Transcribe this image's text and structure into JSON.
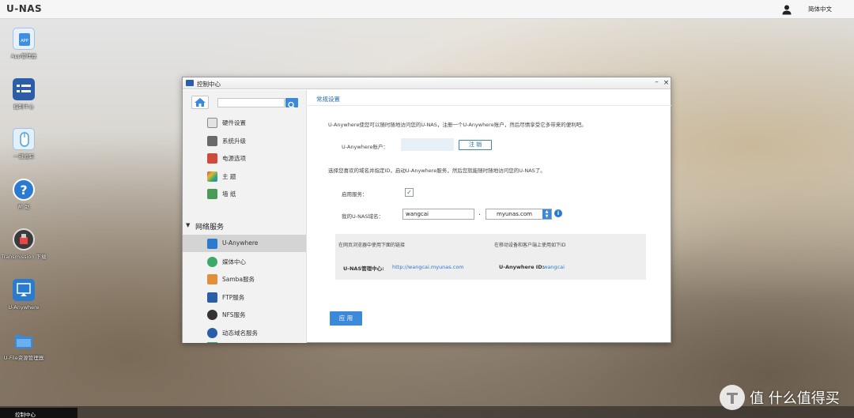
{
  "topbar": {
    "app_title": "U-NAS",
    "language": "简体中文",
    "user_icon": "user-icon"
  },
  "desktop_icons": [
    {
      "label": "App管理器",
      "icon": "app-store-icon",
      "color": "#3f8fe0"
    },
    {
      "label": "控制中心",
      "icon": "control-panel-icon",
      "color": "#2a5ea8"
    },
    {
      "label": "一键追踪",
      "icon": "mouse-icon",
      "color": "#4aa0e0"
    },
    {
      "label": "帮 助",
      "icon": "help-icon",
      "color": "#2a7ad0"
    },
    {
      "label": "Transmission 下载",
      "icon": "transmission-icon",
      "color": "#3a3a3a"
    },
    {
      "label": "U-Anywhere",
      "icon": "u-anywhere-icon",
      "color": "#2a7ad0"
    },
    {
      "label": "U-File资源管理器",
      "icon": "folder-icon",
      "color": "#3b8ad9"
    }
  ],
  "window": {
    "title": "控制中心"
  },
  "sidebar": {
    "search_placeholder": "",
    "items": [
      {
        "label": "硬件设置",
        "icon": "hardware-icon",
        "color": "#8a8a8a"
      },
      {
        "label": "系统升级",
        "icon": "upgrade-icon",
        "color": "#6a6a6a"
      },
      {
        "label": "电源选项",
        "icon": "power-icon",
        "color": "#d04a3a"
      },
      {
        "label": "主 题",
        "icon": "theme-icon",
        "color": "#e0783a"
      },
      {
        "label": "墙 纸",
        "icon": "wallpaper-icon",
        "color": "#4a9a5a"
      }
    ],
    "section": "网络服务",
    "network_items": [
      {
        "label": "U-Anywhere",
        "icon": "u-anywhere-icon",
        "color": "#2a7ad0",
        "active": true
      },
      {
        "label": "媒体中心",
        "icon": "media-center-icon",
        "color": "#3aaa6a"
      },
      {
        "label": "Samba服务",
        "icon": "samba-icon",
        "color": "#e0903a"
      },
      {
        "label": "FTP服务",
        "icon": "ftp-icon",
        "color": "#2a5ea8"
      },
      {
        "label": "NFS服务",
        "icon": "nfs-icon",
        "color": "#333333"
      },
      {
        "label": "动态域名服务",
        "icon": "ddns-icon",
        "color": "#2a5ea8"
      }
    ]
  },
  "content": {
    "title": "常规设置",
    "intro": "U-Anywhere使您可以随时随地访问您的U-NAS，注册一个U-Anywhere账户，然后尽情享受它多带来的便利吧。",
    "account_label": "U-Anywhere账户：",
    "logout_label": "注 销",
    "domain_desc": "选择您喜欢的域名并指定ID，启动U-Anywhere服务，然后您就能随时随地访问您的U-NAS了。",
    "enable_label": "启用服务：",
    "enable_checked": "✓",
    "domain_label": "我的U-NAS域名：",
    "domain_value": "wangcai",
    "domain_dot": ".",
    "domain_suffix": "myunas.com",
    "info_icon": "i",
    "browser_hint": "在网页浏览器中使用下面的链接",
    "mobile_hint": "在移动设备和客户端上使用如下ID",
    "mgmt_label": "U-NAS管理中心:",
    "mgmt_link": "http://wangcai.myunas.com",
    "id_label": "U-Anywhere ID:",
    "id_value": "wangcai",
    "apply_label": "应 用"
  },
  "taskbar": {
    "item": "控制中心"
  },
  "watermark": {
    "text": "值 什么值得买"
  }
}
